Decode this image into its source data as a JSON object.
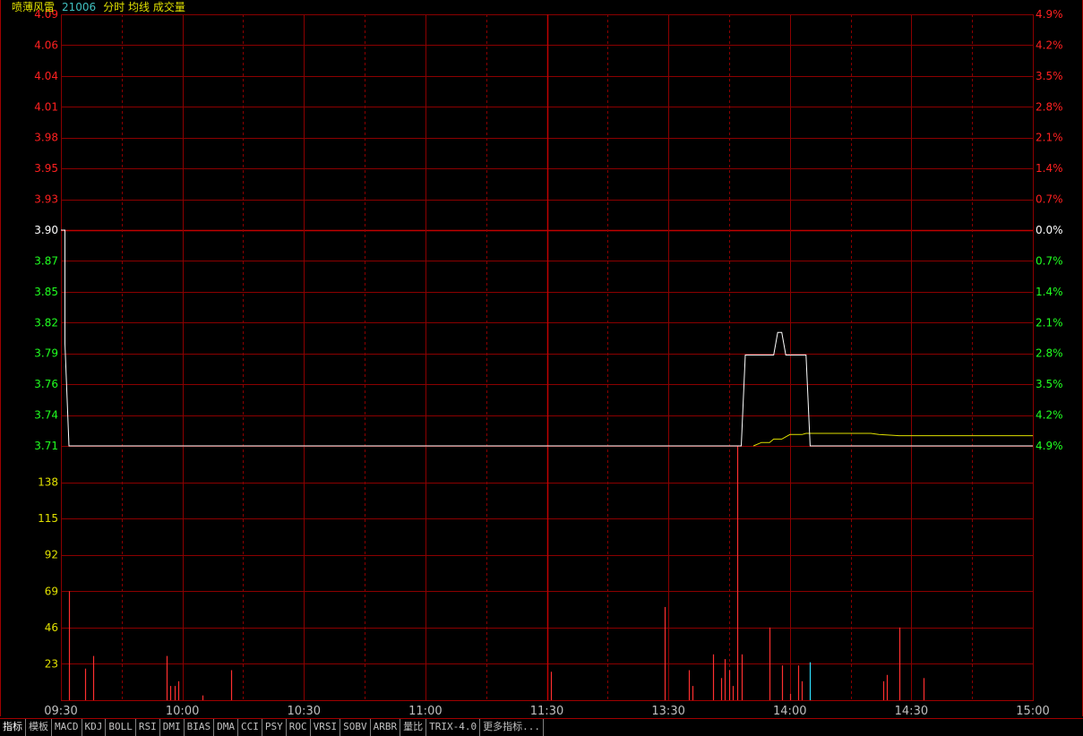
{
  "header": {
    "stock_name": "喷薄风雷",
    "code": "21006",
    "view_label": "分时 均线 成交量"
  },
  "colors": {
    "grid": "#8b0000",
    "frame": "#a00000",
    "up": "#ff2020",
    "down": "#20ff20",
    "flat": "#ffffff",
    "price_line": "#ffffff",
    "avg_line": "#e0e000",
    "volume_up": "#ff3030",
    "volume_down": "#30e0ff",
    "volume_axis": "#e0e000"
  },
  "tabs": [
    "指标",
    "模板",
    "MACD",
    "KDJ",
    "BOLL",
    "RSI",
    "DMI",
    "BIAS",
    "DMA",
    "CCI",
    "PSY",
    "ROC",
    "VRSI",
    "SOBV",
    "ARBR",
    "量比",
    "TRIX-4.0",
    "更多指标..."
  ],
  "chart_data": {
    "type": "line",
    "subtype": "intraday time-sharing chart with volume",
    "prev_close": 3.9,
    "price_axis_labels": [
      "4.09",
      "4.06",
      "4.04",
      "4.01",
      "3.98",
      "3.95",
      "3.93",
      "3.90",
      "3.87",
      "3.85",
      "3.82",
      "3.79",
      "3.76",
      "3.74",
      "3.71"
    ],
    "pct_axis_labels": [
      "4.9%",
      "4.2%",
      "3.5%",
      "2.8%",
      "2.1%",
      "1.4%",
      "0.7%",
      "0.0%",
      "0.7%",
      "1.4%",
      "2.1%",
      "2.8%",
      "3.5%",
      "4.2%",
      "4.9%"
    ],
    "ylim": [
      3.71,
      4.09
    ],
    "time_labels": [
      "09:30",
      "10:00",
      "10:30",
      "11:00",
      "11:30",
      "13:30",
      "14:00",
      "14:30",
      "15:00"
    ],
    "session_minutes": 240,
    "grid": true,
    "price_series": {
      "name": "分时",
      "points": [
        [
          0,
          3.9
        ],
        [
          1,
          3.9
        ],
        [
          1,
          3.8
        ],
        [
          2,
          3.71
        ],
        [
          168,
          3.71
        ],
        [
          169,
          3.79
        ],
        [
          176,
          3.79
        ],
        [
          177,
          3.81
        ],
        [
          178,
          3.81
        ],
        [
          179,
          3.79
        ],
        [
          184,
          3.79
        ],
        [
          185,
          3.71
        ],
        [
          240,
          3.71
        ]
      ]
    },
    "avg_series": {
      "name": "均线",
      "points": [
        [
          171,
          3.71
        ],
        [
          173,
          3.713
        ],
        [
          175,
          3.713
        ],
        [
          176,
          3.716
        ],
        [
          178,
          3.716
        ],
        [
          180,
          3.72
        ],
        [
          183,
          3.72
        ],
        [
          184,
          3.721
        ],
        [
          200,
          3.721
        ],
        [
          202,
          3.72
        ],
        [
          207,
          3.719
        ],
        [
          240,
          3.719
        ]
      ]
    },
    "volume_axis_labels": [
      "138",
      "115",
      "92",
      "69",
      "46",
      "23"
    ],
    "volume_ylim": [
      0,
      161
    ],
    "volume": [
      {
        "t": 2,
        "v": 69,
        "dir": "down"
      },
      {
        "t": 6,
        "v": 20,
        "dir": "down"
      },
      {
        "t": 8,
        "v": 28,
        "dir": "down"
      },
      {
        "t": 26,
        "v": 28,
        "dir": "down"
      },
      {
        "t": 27,
        "v": 9,
        "dir": "down"
      },
      {
        "t": 28,
        "v": 9,
        "dir": "down"
      },
      {
        "t": 29,
        "v": 12,
        "dir": "down"
      },
      {
        "t": 35,
        "v": 3,
        "dir": "down"
      },
      {
        "t": 42,
        "v": 19,
        "dir": "down"
      },
      {
        "t": 121,
        "v": 18,
        "dir": "down"
      },
      {
        "t": 149,
        "v": 59,
        "dir": "down"
      },
      {
        "t": 155,
        "v": 19,
        "dir": "down"
      },
      {
        "t": 156,
        "v": 9,
        "dir": "down"
      },
      {
        "t": 161,
        "v": 29,
        "dir": "down"
      },
      {
        "t": 163,
        "v": 14,
        "dir": "down"
      },
      {
        "t": 164,
        "v": 26,
        "dir": "down"
      },
      {
        "t": 165,
        "v": 19,
        "dir": "down"
      },
      {
        "t": 166,
        "v": 9,
        "dir": "down"
      },
      {
        "t": 167,
        "v": 161,
        "dir": "down"
      },
      {
        "t": 168,
        "v": 29,
        "dir": "down"
      },
      {
        "t": 175,
        "v": 46,
        "dir": "down"
      },
      {
        "t": 178,
        "v": 22,
        "dir": "down"
      },
      {
        "t": 180,
        "v": 4,
        "dir": "down"
      },
      {
        "t": 182,
        "v": 22,
        "dir": "down"
      },
      {
        "t": 183,
        "v": 12,
        "dir": "down"
      },
      {
        "t": 185,
        "v": 24,
        "dir": "up"
      },
      {
        "t": 203,
        "v": 12,
        "dir": "down"
      },
      {
        "t": 204,
        "v": 16,
        "dir": "down"
      },
      {
        "t": 207,
        "v": 46,
        "dir": "down"
      },
      {
        "t": 213,
        "v": 14,
        "dir": "down"
      }
    ]
  }
}
